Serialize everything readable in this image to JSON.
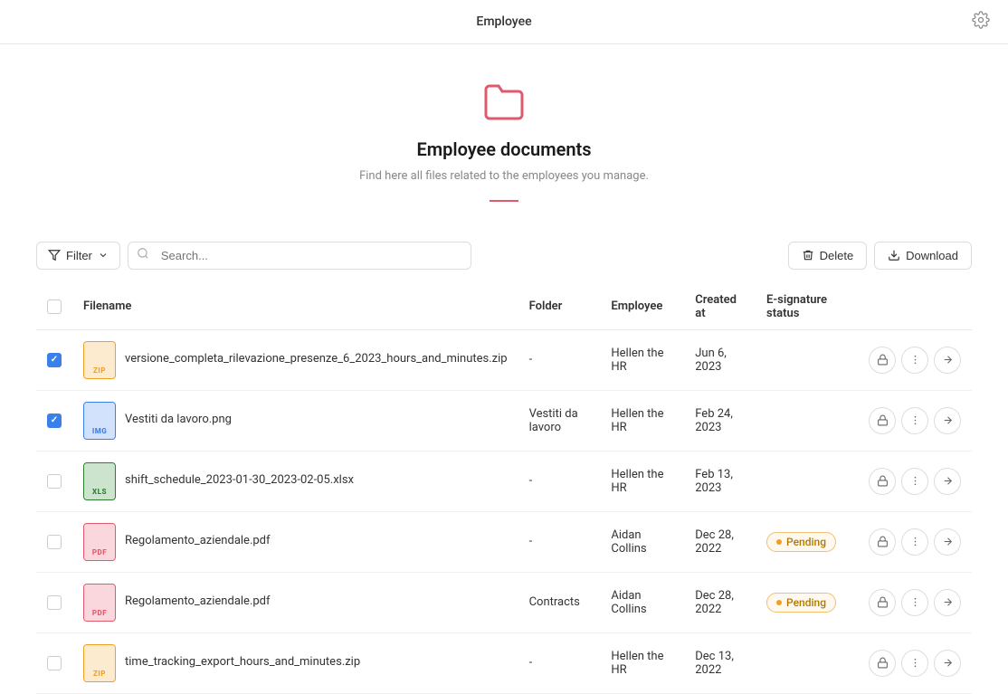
{
  "header": {
    "title": "Employee",
    "gear_label": "settings"
  },
  "hero": {
    "title": "Employee documents",
    "subtitle": "Find here all files related to the employees you manage."
  },
  "toolbar": {
    "filter_label": "Filter",
    "search_placeholder": "Search...",
    "delete_label": "Delete",
    "download_label": "Download"
  },
  "table": {
    "columns": [
      "Filename",
      "Folder",
      "Employee",
      "Created at",
      "E-signature status"
    ],
    "rows": [
      {
        "id": 1,
        "checked": true,
        "file_type": "ZIP",
        "file_name": "versione_completa_rilevazione_presenze_6_2023_hours_and_minutes.zip",
        "folder": "-",
        "employee": "Hellen the HR",
        "created_at": "Jun 6, 2023",
        "status": ""
      },
      {
        "id": 2,
        "checked": true,
        "file_type": "IMG",
        "file_name": "Vestiti da lavoro.png",
        "folder": "Vestiti da lavoro",
        "employee": "Hellen the HR",
        "created_at": "Feb 24, 2023",
        "status": ""
      },
      {
        "id": 3,
        "checked": false,
        "file_type": "XLS",
        "file_name": "shift_schedule_2023-01-30_2023-02-05.xlsx",
        "folder": "-",
        "employee": "Hellen the HR",
        "created_at": "Feb 13, 2023",
        "status": ""
      },
      {
        "id": 4,
        "checked": false,
        "file_type": "PDF",
        "file_name": "Regolamento_aziendale.pdf",
        "folder": "-",
        "employee": "Aidan Collins",
        "created_at": "Dec 28, 2022",
        "status": "Pending"
      },
      {
        "id": 5,
        "checked": false,
        "file_type": "PDF",
        "file_name": "Regolamento_aziendale.pdf",
        "folder": "Contracts",
        "employee": "Aidan Collins",
        "created_at": "Dec 28, 2022",
        "status": "Pending"
      },
      {
        "id": 6,
        "checked": false,
        "file_type": "ZIP",
        "file_name": "time_tracking_export_hours_and_minutes.zip",
        "folder": "-",
        "employee": "Hellen the HR",
        "created_at": "Dec 13, 2022",
        "status": ""
      }
    ]
  }
}
